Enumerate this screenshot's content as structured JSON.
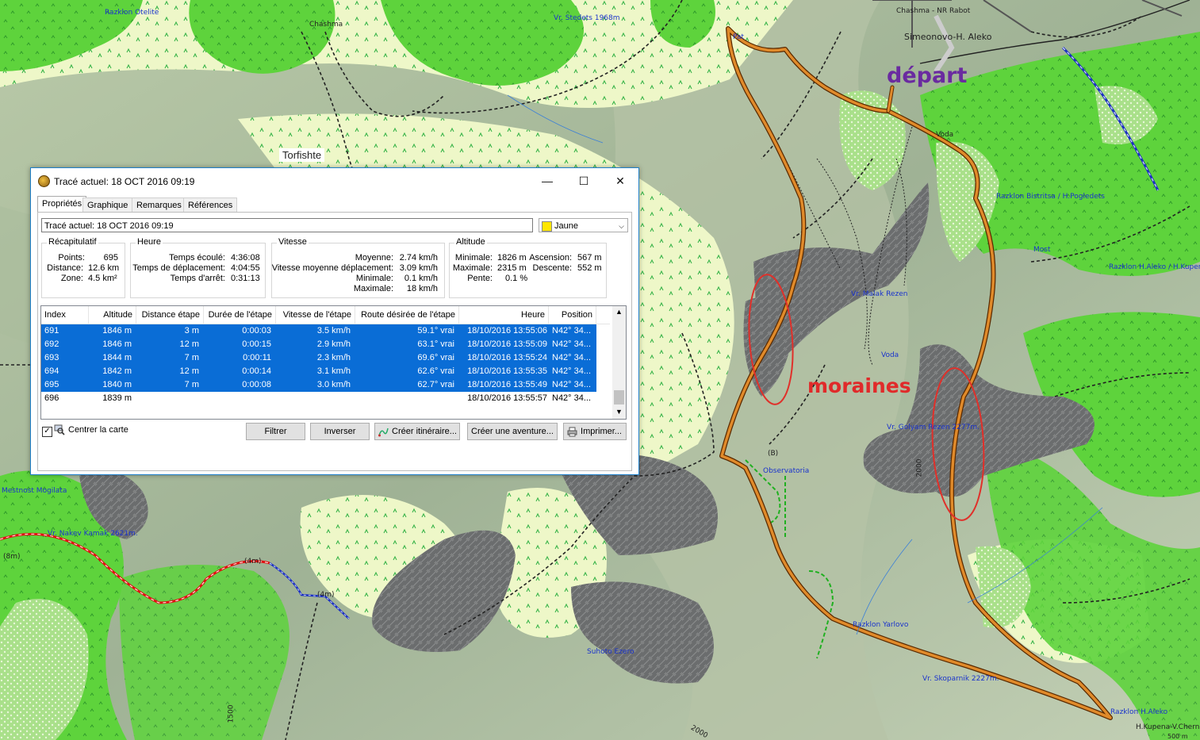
{
  "map": {
    "annotations": {
      "depart": "départ",
      "moraines": "moraines"
    },
    "labels": {
      "torfishte": "Torfishte",
      "razklon_otelite": "Razklon Otelite",
      "vr_stedets": "Vr. Stedets 1968m",
      "chashma_top": "Chashma",
      "chashma_nr": "Chashma - NR Rabot",
      "simeonovo": "Simeonovo-H. Aleko",
      "pat": "Pat",
      "voda_top": "Voda",
      "razklon_bistritsa": "Razklon Bistritsa / H.Pogledets",
      "most": "Most",
      "razklon_aleko_kupena": "Razklon H.Aleko / H.Kupena",
      "vr_malak_rezen": "Vr. Malak Rezen",
      "voda_mid": "Voda",
      "vr_golyam_rezen": "Vr. Golyam Rezen 2277m.",
      "observatoria": "Observatoria",
      "mestnost_mogilata": "Mestnost Mogilata",
      "vr_nakev_kamak": "Vr. Nakev Kamak 2621m.",
      "suhoto_ezero": "Suhoto Ezero",
      "razklon_yarlovo": "Razklon Yarlovo",
      "vr_skoparnik": "Vr. Skoparnik 2227m.",
      "razklon_aleko": "Razklon H.Aleko",
      "kupena_cherni": "H.Kupena-V.Cherni",
      "elev_2000_a": "2000",
      "elev_2000_b": "2000",
      "elev_1500": "1500",
      "elev_500": "500 m",
      "trail_4m": "(4m)",
      "trail_8m": "(8m)",
      "trail_4m_b": "(4m)",
      "trail_b": "(B)"
    }
  },
  "window": {
    "title": "Tracé actuel: 18 OCT 2016 09:19",
    "controls": {
      "minimize": "—",
      "maximize": "☐",
      "close": "✕"
    },
    "tabs": [
      "Propriétés",
      "Graphique",
      "Remarques",
      "Références"
    ],
    "name_value": "Tracé actuel: 18 OCT 2016 09:19",
    "color": {
      "label": "Jaune",
      "swatch": "#ffe600"
    },
    "summary": {
      "title": "Récapitulatif",
      "points_label": "Points:",
      "points": "695",
      "distance_label": "Distance:",
      "distance": "12.6 km",
      "zone_label": "Zone:",
      "zone": "4.5 km²"
    },
    "time": {
      "title": "Heure",
      "elapsed_label": "Temps écoulé:",
      "elapsed": "4:36:08",
      "moving_label": "Temps de déplacement:",
      "moving": "4:04:55",
      "stopped_label": "Temps d'arrêt:",
      "stopped": "0:31:13"
    },
    "speed": {
      "title": "Vitesse",
      "avg_label": "Moyenne:",
      "avg": "2.74 km/h",
      "moving_avg_label": "Vitesse moyenne déplacement:",
      "moving_avg": "3.09 km/h",
      "min_label": "Minimale:",
      "min": "0.1 km/h",
      "max_label": "Maximale:",
      "max": "18 km/h"
    },
    "altitude": {
      "title": "Altitude",
      "min_label": "Minimale:",
      "min": "1826 m",
      "max_label": "Maximale:",
      "max": "2315 m",
      "slope_label": "Pente:",
      "slope": "0.1 %",
      "ascent_label": "Ascension:",
      "ascent": "567 m",
      "descent_label": "Descente:",
      "descent": "552 m"
    },
    "table": {
      "headers": [
        "Index",
        "Altitude",
        "Distance étape",
        "Durée de l'étape",
        "Vitesse de l'étape",
        "Route désirée de l'étape",
        "Heure",
        "Position"
      ],
      "rows": [
        [
          "691",
          "1846 m",
          "3 m",
          "0:00:03",
          "3.5 km/h",
          "59.1° vrai",
          "18/10/2016 13:55:06",
          "N42° 34..."
        ],
        [
          "692",
          "1846 m",
          "12 m",
          "0:00:15",
          "2.9 km/h",
          "63.1° vrai",
          "18/10/2016 13:55:09",
          "N42° 34..."
        ],
        [
          "693",
          "1844 m",
          "7 m",
          "0:00:11",
          "2.3 km/h",
          "69.6° vrai",
          "18/10/2016 13:55:24",
          "N42° 34..."
        ],
        [
          "694",
          "1842 m",
          "12 m",
          "0:00:14",
          "3.1 km/h",
          "62.6° vrai",
          "18/10/2016 13:55:35",
          "N42° 34..."
        ],
        [
          "695",
          "1840 m",
          "7 m",
          "0:00:08",
          "3.0 km/h",
          "62.7° vrai",
          "18/10/2016 13:55:49",
          "N42° 34..."
        ],
        [
          "696",
          "1839 m",
          "",
          "",
          "",
          "",
          "18/10/2016 13:55:57",
          "N42° 34..."
        ]
      ],
      "selected_rows": [
        0,
        1,
        2,
        3,
        4
      ]
    },
    "center_map_label": "Centrer la carte",
    "center_map_checked": true,
    "buttons": {
      "filter": "Filtrer",
      "invert": "Inverser",
      "create_route": "Créer itinéraire...",
      "create_adventure": "Créer une aventure...",
      "print": "Imprimer..."
    }
  }
}
